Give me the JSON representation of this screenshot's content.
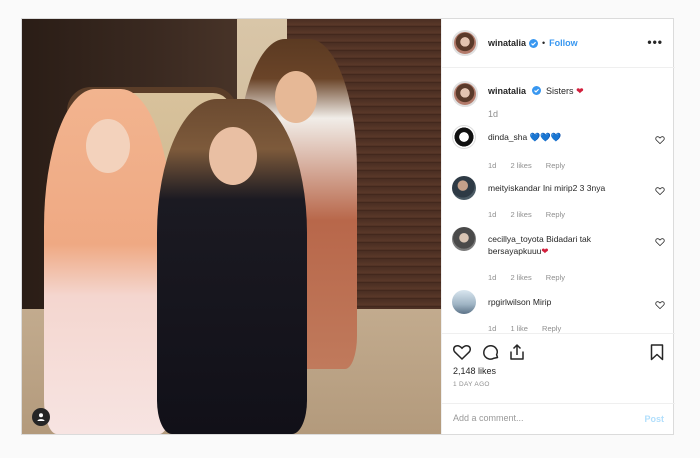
{
  "header": {
    "username": "winatalia",
    "separator": "•",
    "follow_label": "Follow",
    "more_label": "•••"
  },
  "caption": {
    "username": "winatalia",
    "text": "Sisters",
    "emoji": "❤",
    "time": "1d"
  },
  "comments": [
    {
      "username": "dinda_sha",
      "text": "",
      "emoji": "💙💙💙",
      "time": "1d",
      "likes": "2 likes",
      "reply": "Reply"
    },
    {
      "username": "meityiskandar",
      "text": "Ini mirip2 3 3nya",
      "emoji": "",
      "time": "1d",
      "likes": "2 likes",
      "reply": "Reply"
    },
    {
      "username": "cecillya_toyota",
      "text": "Bidadari tak bersayapkuuu",
      "emoji": "❤",
      "time": "1d",
      "likes": "2 likes",
      "reply": "Reply"
    },
    {
      "username": "rpgirlwilson",
      "text": "Mirip",
      "emoji": "",
      "time": "1d",
      "likes": "1 like",
      "reply": "Reply"
    }
  ],
  "stats": {
    "likes": "2,148 likes",
    "ago": "1 DAY AGO"
  },
  "add_comment": {
    "placeholder": "Add a comment...",
    "post_label": "Post"
  },
  "colors": {
    "link_blue": "#3897f0",
    "muted": "#8e8e8e",
    "verified_blue": "#3897f0"
  }
}
